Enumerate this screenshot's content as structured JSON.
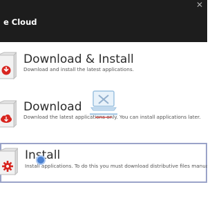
{
  "window": {
    "title": "e Cloud",
    "close_label": "✕"
  },
  "options": [
    {
      "title": "Download & Install",
      "description": "Download and install the latest applications.",
      "icon": "box-download-install-icon"
    },
    {
      "title": "Download",
      "description": "Download the latest applications only. You can install applications later.",
      "icon": "box-download-icon"
    },
    {
      "title": "Install",
      "description": "Install applications. To do this you must download distributive files manually.",
      "icon": "box-install-icon",
      "selected": true
    }
  ],
  "colors": {
    "titlebar": "#1d1d1d",
    "accent_red": "#d8251f",
    "selection_border": "#9aa3c8"
  }
}
